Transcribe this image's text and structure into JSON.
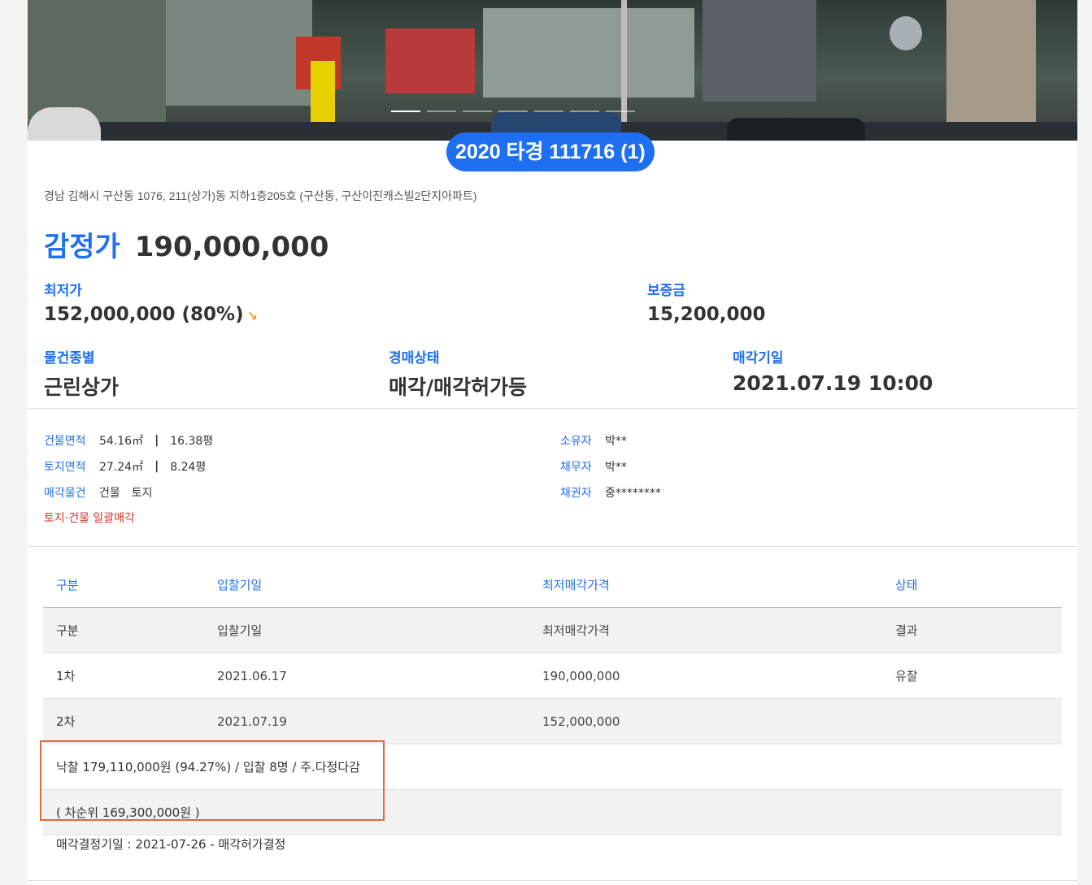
{
  "hero": {
    "slides": 7,
    "active_slide": 1
  },
  "case_number": "2020 타경 111716 (1)",
  "address": "경남 김해시 구산동 1076, 211(상가)동 지하1층205호 (구산동, 구산이진캐스빌2단지아파트)",
  "appraisal": {
    "label": "감정가",
    "value": "190,000,000"
  },
  "minimum_price": {
    "label": "최저가",
    "value": "152,000,000 (80%)",
    "trend_icon": "↘"
  },
  "deposit": {
    "label": "보증금",
    "value": "15,200,000"
  },
  "property_type": {
    "label": "물건종별",
    "value": "근린상가"
  },
  "auction_status": {
    "label": "경매상태",
    "value": "매각/매각허가등"
  },
  "sale_date": {
    "label": "매각기일",
    "value": "2021.07.19 10:00"
  },
  "details": {
    "building_area": {
      "label": "건물면적",
      "sqm": "54.16㎡",
      "pyeong": "16.38평"
    },
    "land_area": {
      "label": "토지면적",
      "sqm": "27.24㎡",
      "pyeong": "8.24평"
    },
    "sale_items": {
      "label": "매각물건",
      "item1": "건물",
      "item2": "토지"
    },
    "bulk_sale": "토지·건물 일괄매각",
    "owner": {
      "label": "소유자",
      "value": "박**"
    },
    "debtor": {
      "label": "채무자",
      "value": "박**"
    },
    "creditor": {
      "label": "채권자",
      "value": "중********"
    }
  },
  "table": {
    "headers": [
      "구분",
      "입찰기일",
      "최저매각가격",
      "상태"
    ],
    "rows": [
      [
        "구분",
        "입찰기일",
        "최저매각가격",
        "결과"
      ],
      [
        "1차",
        "2021.06.17",
        "190,000,000",
        "유찰"
      ],
      [
        "2차",
        "2021.07.19",
        "152,000,000",
        ""
      ]
    ],
    "winning_bid": "낙찰 179,110,000원 (94.27%) / 입찰 8명 / 주.다정다감",
    "second_bidder": "( 차순위 169,300,000원 )",
    "decision": "매각결정기일 : 2021-07-26 - 매각허가결정"
  },
  "colors": {
    "accent": "#1e6ff1",
    "bulk_sale_red": "#d0342c",
    "highlight_border": "#e06a3e"
  }
}
